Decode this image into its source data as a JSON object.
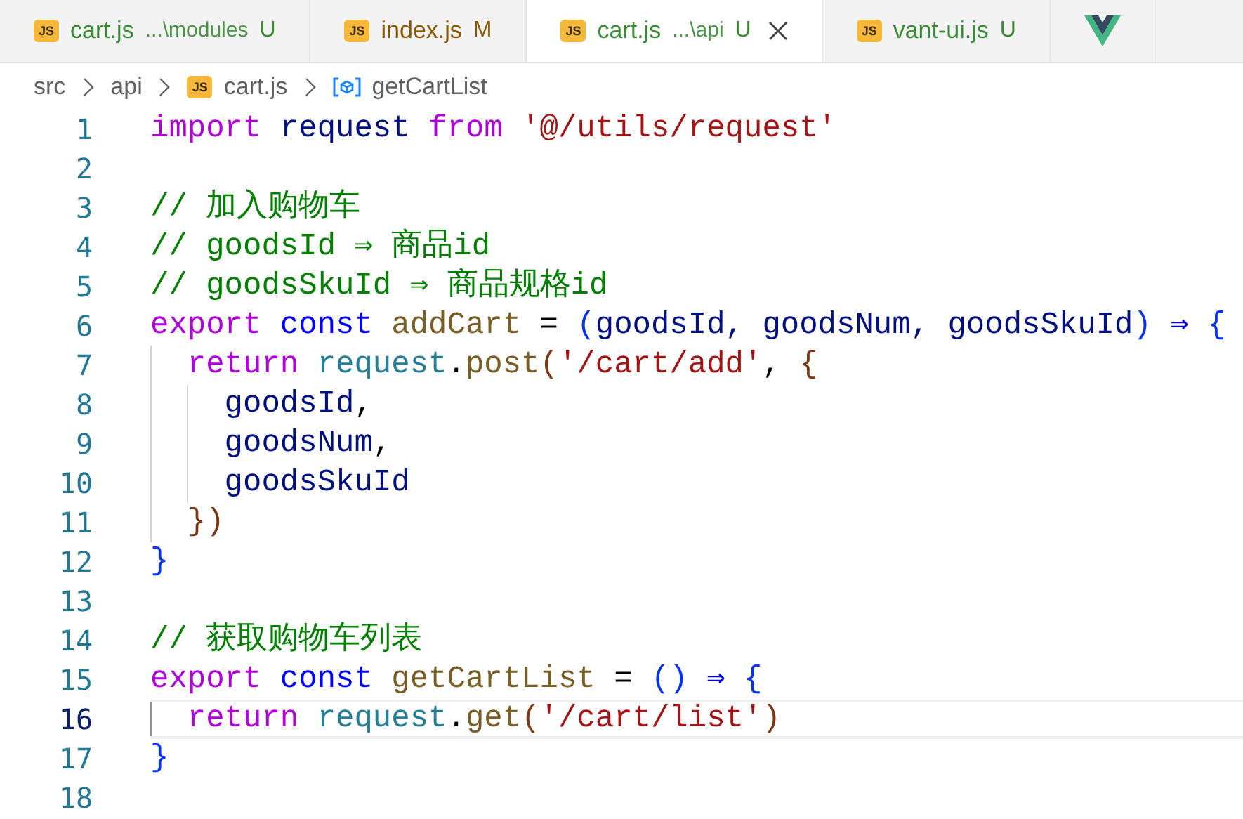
{
  "tabs": [
    {
      "kind": "js",
      "icon": "JS",
      "label": "cart.js",
      "path": "...\\modules",
      "status": "U",
      "selected": false
    },
    {
      "kind": "js",
      "icon": "JS",
      "label": "index.js",
      "status": "M",
      "selected": false
    },
    {
      "kind": "js",
      "icon": "JS",
      "label": "cart.js",
      "path": "...\\api",
      "status": "U",
      "selected": true
    },
    {
      "kind": "js",
      "icon": "JS",
      "label": "vant-ui.js",
      "status": "U",
      "selected": false
    },
    {
      "kind": "vue",
      "selected": false
    }
  ],
  "breadcrumb": [
    {
      "kind": "folder",
      "label": "src"
    },
    {
      "kind": "folder",
      "label": "api"
    },
    {
      "kind": "js",
      "icon": "JS",
      "label": "cart.js"
    },
    {
      "kind": "symbol",
      "label": "getCartList"
    }
  ],
  "editor": {
    "lines": [
      {
        "number": "1",
        "current": false,
        "tokens": [
          {
            "text": "import ",
            "kind": "keyword"
          },
          {
            "text": "request ",
            "kind": "variable"
          },
          {
            "text": "from ",
            "kind": "keyword"
          },
          {
            "text": "'@/utils/request'",
            "kind": "string"
          }
        ]
      },
      {
        "number": "2",
        "current": false
      },
      {
        "number": "3",
        "current": false,
        "tokens": [
          {
            "text": "// 加入购物车",
            "kind": "comment"
          }
        ]
      },
      {
        "number": "4",
        "current": false,
        "tokens": [
          {
            "text": "// goodsId ⇒ 商品id",
            "kind": "comment"
          }
        ]
      },
      {
        "number": "5",
        "current": false,
        "tokens": [
          {
            "text": "// goodsSkuId ⇒ 商品规格id",
            "kind": "comment"
          }
        ]
      },
      {
        "number": "6",
        "current": false,
        "tokens": [
          {
            "text": "export ",
            "kind": "keyword"
          },
          {
            "text": "const ",
            "kind": "storage"
          },
          {
            "text": "addCart",
            "kind": "function"
          },
          {
            "text": " = ",
            "kind": "plain"
          },
          {
            "text": "(",
            "kind": "bracket1"
          },
          {
            "text": "goodsId, goodsNum, goodsSkuId",
            "kind": "variable"
          },
          {
            "text": ") ",
            "kind": "bracket1"
          },
          {
            "text": "⇒ ",
            "kind": "storage"
          },
          {
            "text": "{",
            "kind": "bracket1"
          }
        ]
      },
      {
        "number": "7",
        "current": false,
        "tokens": [
          {
            "text": "  return ",
            "kind": "keyword"
          },
          {
            "text": "request",
            "kind": "object"
          },
          {
            "text": ".",
            "kind": "plain"
          },
          {
            "text": "post",
            "kind": "function"
          },
          {
            "text": "(",
            "kind": "bracket2"
          },
          {
            "text": "'/cart/add'",
            "kind": "string"
          },
          {
            "text": ", ",
            "kind": "plain"
          },
          {
            "text": "{",
            "kind": "bracket2"
          }
        ]
      },
      {
        "number": "8",
        "current": false,
        "tokens": [
          {
            "text": "    goodsId",
            "kind": "variable"
          },
          {
            "text": ",",
            "kind": "plain"
          }
        ]
      },
      {
        "number": "9",
        "current": false,
        "tokens": [
          {
            "text": "    goodsNum",
            "kind": "variable"
          },
          {
            "text": ",",
            "kind": "plain"
          }
        ]
      },
      {
        "number": "10",
        "current": false,
        "tokens": [
          {
            "text": "    goodsSkuId",
            "kind": "variable"
          }
        ]
      },
      {
        "number": "11",
        "current": false,
        "tokens": [
          {
            "text": "  })",
            "kind": "bracket2"
          }
        ]
      },
      {
        "number": "12",
        "current": false,
        "tokens": [
          {
            "text": "}",
            "kind": "bracket1"
          }
        ]
      },
      {
        "number": "13",
        "current": false
      },
      {
        "number": "14",
        "current": false,
        "tokens": [
          {
            "text": "// 获取购物车列表",
            "kind": "comment"
          }
        ]
      },
      {
        "number": "15",
        "current": false,
        "tokens": [
          {
            "text": "export ",
            "kind": "keyword"
          },
          {
            "text": "const ",
            "kind": "storage"
          },
          {
            "text": "getCartList",
            "kind": "function"
          },
          {
            "text": " = ",
            "kind": "plain"
          },
          {
            "text": "() ",
            "kind": "bracket1"
          },
          {
            "text": "⇒ ",
            "kind": "storage"
          },
          {
            "text": "{",
            "kind": "bracket1"
          }
        ]
      },
      {
        "number": "16",
        "current": true,
        "tokens": [
          {
            "text": "  return ",
            "kind": "keyword"
          },
          {
            "text": "request",
            "kind": "object"
          },
          {
            "text": ".",
            "kind": "plain"
          },
          {
            "text": "get",
            "kind": "function"
          },
          {
            "text": "(",
            "kind": "bracket2"
          },
          {
            "text": "'/cart/list'",
            "kind": "string"
          },
          {
            "text": ")",
            "kind": "bracket2"
          }
        ]
      },
      {
        "number": "17",
        "current": false,
        "tokens": [
          {
            "text": "}",
            "kind": "bracket1"
          }
        ]
      },
      {
        "number": "18",
        "current": false
      }
    ]
  }
}
